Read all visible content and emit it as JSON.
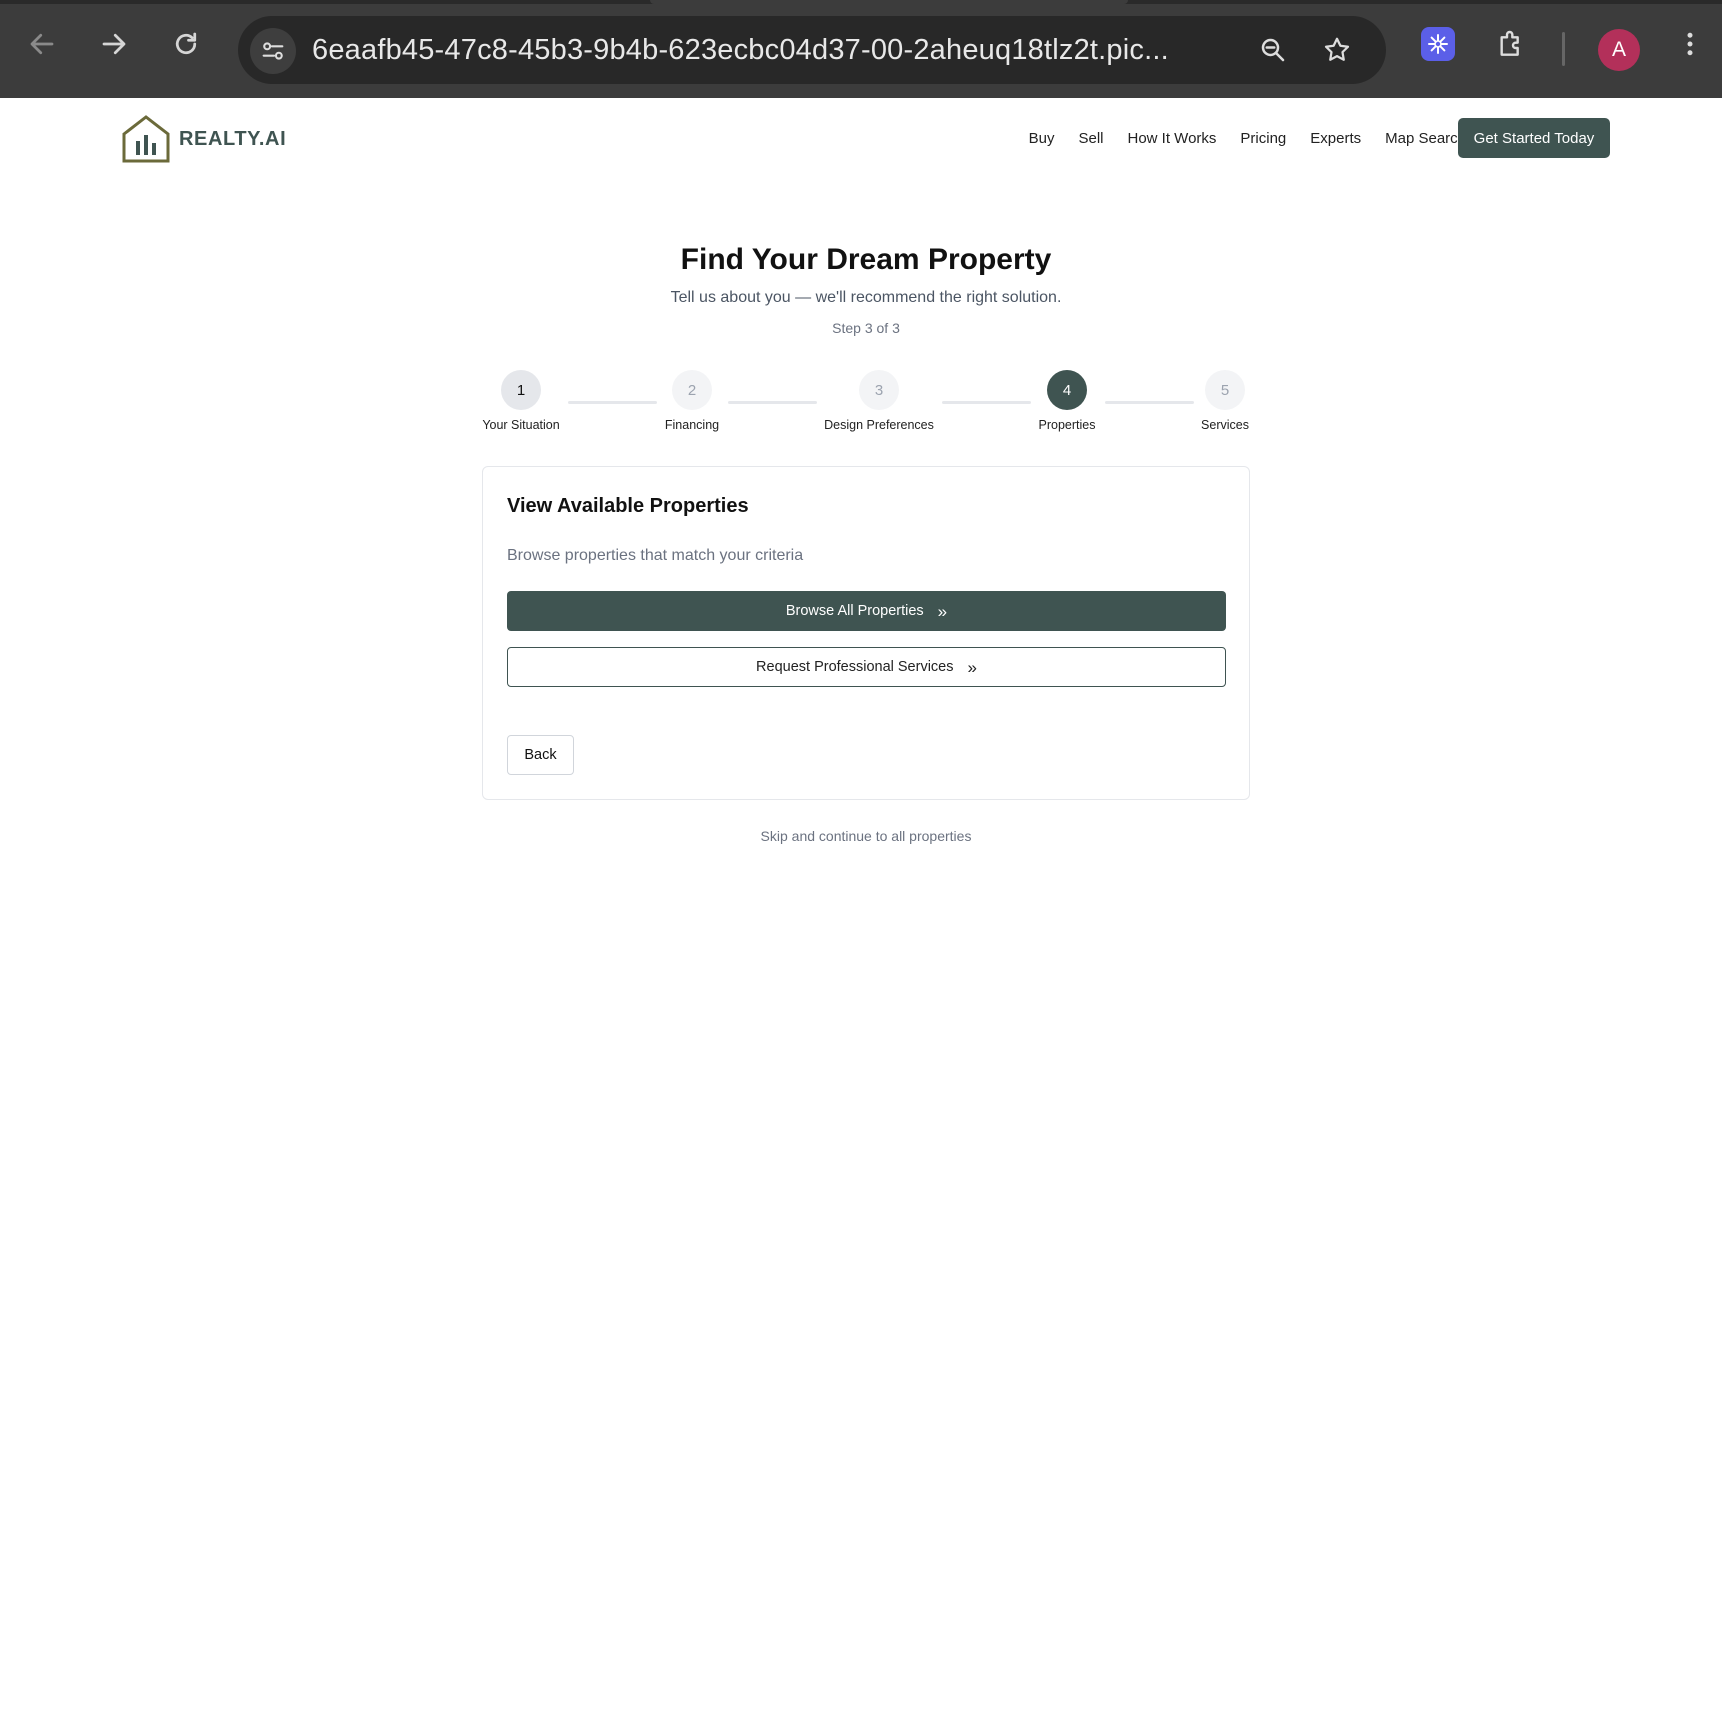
{
  "browser": {
    "url": "6eaafb45-47c8-45b3-9b4b-623ecbc04d37-00-2aheuq18tlz2t.pic...",
    "profile_initial": "A",
    "icons": [
      "back-icon",
      "forward-icon",
      "reload-icon",
      "site-settings-icon",
      "zoom-icon",
      "bookmark-star-icon",
      "extension-snowflake-icon",
      "extensions-puzzle-icon",
      "more-menu-icon"
    ]
  },
  "header": {
    "logo_text": "REALTY.AI",
    "nav": [
      "Buy",
      "Sell",
      "How It Works",
      "Pricing",
      "Experts",
      "Map Search"
    ],
    "cta_label": "Get Started Today"
  },
  "hero": {
    "title": "Find Your Dream Property",
    "subtitle": "Tell us about you — we'll recommend the right solution.",
    "step_label": "Step 3 of 3"
  },
  "stepper": {
    "steps": [
      {
        "number": "1",
        "label": "Your Situation",
        "state": "done"
      },
      {
        "number": "2",
        "label": "Financing",
        "state": "todo"
      },
      {
        "number": "3",
        "label": "Design Preferences",
        "state": "todo"
      },
      {
        "number": "4",
        "label": "Properties",
        "state": "active"
      },
      {
        "number": "5",
        "label": "Services",
        "state": "todo"
      }
    ]
  },
  "card": {
    "title": "View Available Properties",
    "description": "Browse properties that match your criteria",
    "primary_label": "Browse All Properties",
    "secondary_label": "Request Professional Services",
    "chevron": "»",
    "back_label": "Back"
  },
  "footer": {
    "skip_label": "Skip and continue to all properties"
  },
  "colors": {
    "accent": "#3f5451",
    "logo_outline": "#6b6a3a",
    "avatar": "#b3305a",
    "extension": "#5b5fe8"
  }
}
